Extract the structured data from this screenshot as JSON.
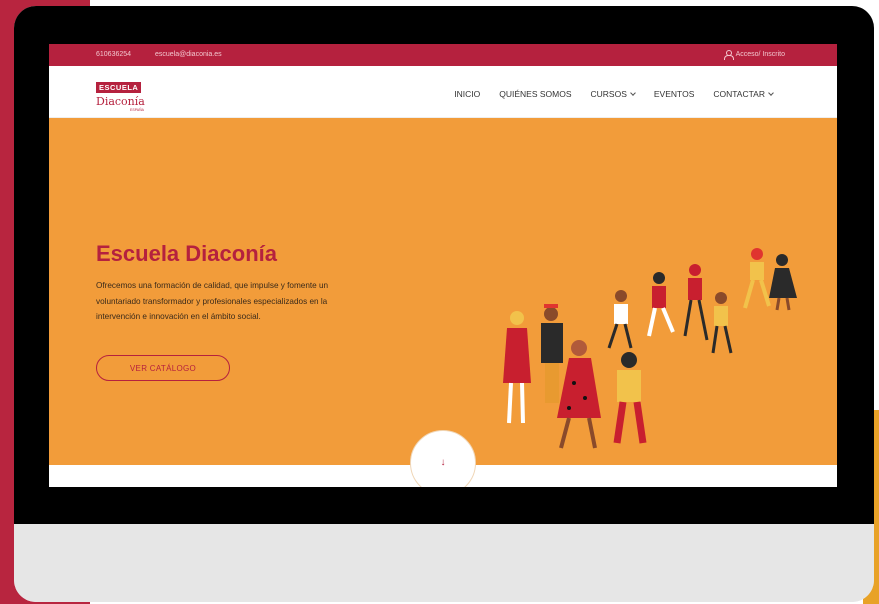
{
  "colors": {
    "brand": "#b5213e",
    "hero_bg": "#f29c3a",
    "bezel": "#000000",
    "accent_yellow": "#e8a227"
  },
  "topbar": {
    "phone": "610636254",
    "email": "escuela@diaconia.es",
    "login": "Acceso/ Inscrito",
    "login_icon": "user-icon"
  },
  "logo": {
    "top": "ESCUELA",
    "bottom": "Diaconía",
    "sub": "ESPAÑA"
  },
  "nav": {
    "items": [
      {
        "label": "INICIO"
      },
      {
        "label": "QUIÉNES SOMOS"
      },
      {
        "label": "CURSOS"
      },
      {
        "label": "EVENTOS"
      },
      {
        "label": "CONTACTAR"
      }
    ]
  },
  "hero": {
    "title": "Escuela Diaconía",
    "description": "Ofrecemos una formación de calidad, que impulse y fomente un voluntariado transformador y profesionales especializados en la intervención e innovación en el ámbito social.",
    "cta": "VER CATÁLOGO",
    "scroll_icon": "arrow-down-icon",
    "scroll_glyph": "↓",
    "illustration": "dancing-people-illustration"
  }
}
